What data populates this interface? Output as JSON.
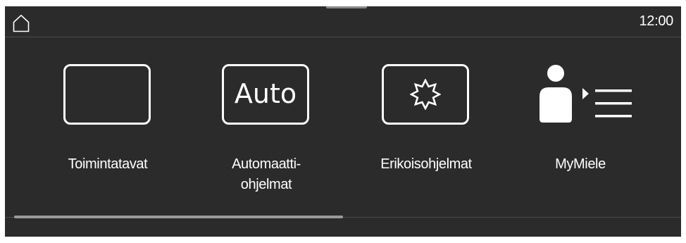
{
  "status_bar": {
    "home_icon": "home-icon",
    "time": "12:00"
  },
  "tiles": [
    {
      "label": "Toimintatavat",
      "icon": "operating-modes-icon"
    },
    {
      "label_line1": "Automaatti-",
      "label_line2": "ohjelmat",
      "icon": "auto-programs-icon",
      "icon_text": "Auto"
    },
    {
      "label": "Erikoisohjelmat",
      "icon": "special-programs-icon"
    },
    {
      "label": "MyMiele",
      "icon": "mymiele-icon"
    }
  ],
  "scroll": {
    "position_fraction": 0.0,
    "visible_fraction": 0.5
  },
  "colors": {
    "background": "#2b2b2b",
    "text": "#ffffff",
    "divider": "#4a4a4a",
    "scroll_thumb": "#9a9a9a"
  }
}
